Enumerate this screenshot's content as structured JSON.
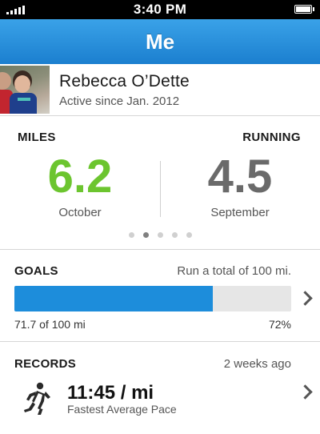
{
  "status_bar": {
    "time": "3:40 PM"
  },
  "nav": {
    "title": "Me"
  },
  "profile": {
    "name": "Rebecca O’Dette",
    "subtitle": "Active since Jan. 2012"
  },
  "stats": {
    "left_label": "MILES",
    "right_label": "RUNNING",
    "current": {
      "value": "6.2",
      "month": "October",
      "color": "#6cc52f"
    },
    "previous": {
      "value": "4.5",
      "month": "September",
      "color": "#6a6a6a"
    },
    "page_count": 5,
    "active_page": 2
  },
  "goals": {
    "title": "GOALS",
    "description": "Run a total of 100 mi.",
    "progress_text": "71.7 of 100 mi",
    "percent_text": "72%",
    "progress_fraction": 0.717,
    "fill_color": "#1d8ddb"
  },
  "records": {
    "title": "RECORDS",
    "when": "2 weeks ago",
    "value": "11:45 / mi",
    "label": "Fastest Average Pace",
    "icon": "runner-icon"
  },
  "accent": "#1b7fcf"
}
